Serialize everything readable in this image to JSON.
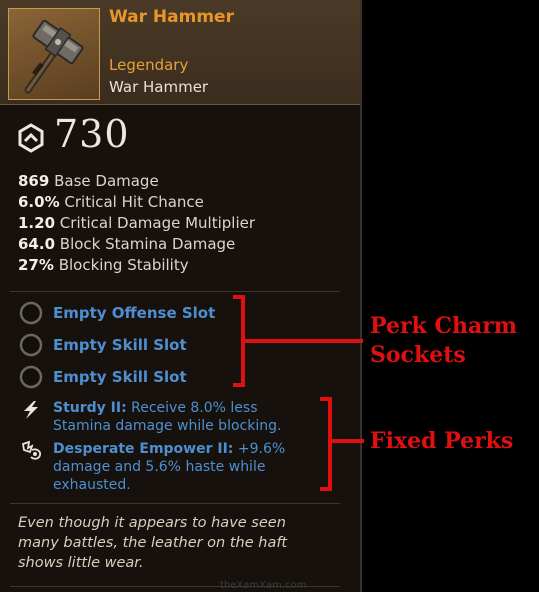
{
  "item": {
    "name": "War Hammer",
    "rarity": "Legendary",
    "type": "War Hammer",
    "icon": "war-hammer-icon"
  },
  "gear_score": {
    "value": "730",
    "icon": "gear-score-hexagon-icon"
  },
  "stats": [
    {
      "value": "869",
      "label": "Base Damage"
    },
    {
      "value": "6.0%",
      "label": "Critical Hit Chance"
    },
    {
      "value": "1.20",
      "label": "Critical Damage Multiplier"
    },
    {
      "value": "64.0",
      "label": "Block Stamina Damage"
    },
    {
      "value": "27%",
      "label": "Blocking Stability"
    }
  ],
  "sockets": [
    {
      "label": "Empty Offense Slot"
    },
    {
      "label": "Empty Skill Slot"
    },
    {
      "label": "Empty Skill Slot"
    }
  ],
  "perks": [
    {
      "icon": "lightning-bolt-icon",
      "name": "Sturdy II:",
      "lines": [
        "Receive 8.0% less",
        "Stamina damage while blocking."
      ]
    },
    {
      "icon": "desperate-empower-icon",
      "name": "Desperate Empower II:",
      "lines": [
        "+9.6%",
        "damage and 5.6% haste while",
        "exhausted."
      ]
    }
  ],
  "flavor_text": [
    "Even though it appears to have seen",
    "many battles, the leather on the haft",
    "shows little wear."
  ],
  "annotations": {
    "perk_charm_sockets": [
      "Perk Charm",
      "Sockets"
    ],
    "fixed_perks": "Fixed Perks",
    "color": "#e01010"
  },
  "watermark": "theXamXam.com",
  "colors": {
    "item_name": "#e8952a",
    "rarity": "#e3a13a",
    "perk_blue": "#4e8fd0",
    "panel_bg": "#16110d"
  }
}
